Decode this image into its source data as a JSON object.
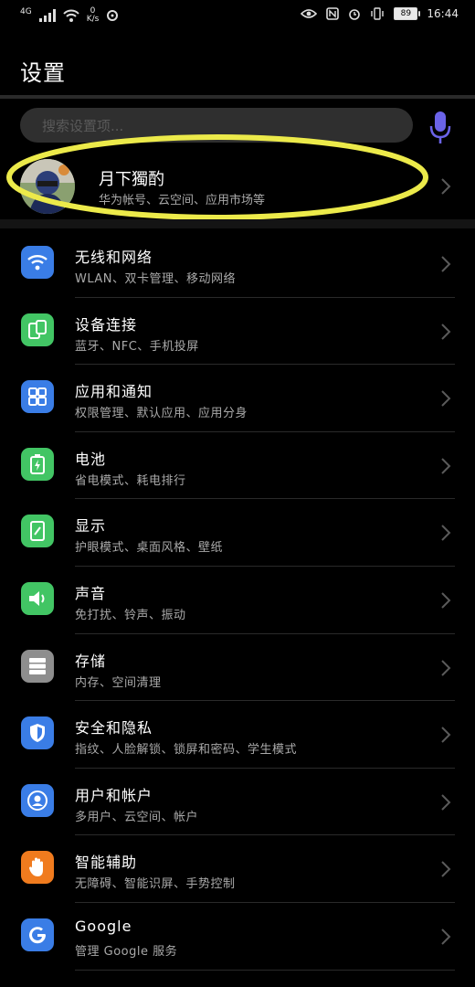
{
  "status_bar": {
    "network": "4G",
    "speed_value": "0",
    "speed_unit": "K/s",
    "battery": "89",
    "time": "16:44"
  },
  "header": {
    "title": "设置"
  },
  "search": {
    "placeholder": "搜索设置项..."
  },
  "account": {
    "name": "月下獨酌",
    "subtitle": "华为帐号、云空间、应用市场等"
  },
  "colors": {
    "background": "#000000",
    "highlight_ellipse": "#ecea4a",
    "mic": "#6b63e8"
  },
  "settings": {
    "items": [
      {
        "title": "无线和网络",
        "subtitle": "WLAN、双卡管理、移动网络",
        "icon": "wifi-icon",
        "color": "#3a7de6"
      },
      {
        "title": "设备连接",
        "subtitle": "蓝牙、NFC、手机投屏",
        "icon": "device-connect-icon",
        "color": "#42c564"
      },
      {
        "title": "应用和通知",
        "subtitle": "权限管理、默认应用、应用分身",
        "icon": "apps-icon",
        "color": "#3a7de6"
      },
      {
        "title": "电池",
        "subtitle": "省电模式、耗电排行",
        "icon": "battery-icon",
        "color": "#42c564"
      },
      {
        "title": "显示",
        "subtitle": "护眼模式、桌面风格、壁纸",
        "icon": "display-icon",
        "color": "#42c564"
      },
      {
        "title": "声音",
        "subtitle": "免打扰、铃声、振动",
        "icon": "sound-icon",
        "color": "#42c564"
      },
      {
        "title": "存储",
        "subtitle": "内存、空间清理",
        "icon": "storage-icon",
        "color": "#8e8e8e"
      },
      {
        "title": "安全和隐私",
        "subtitle": "指纹、人脸解锁、锁屏和密码、学生模式",
        "icon": "shield-icon",
        "color": "#3a7de6"
      },
      {
        "title": "用户和帐户",
        "subtitle": "多用户、云空间、帐户",
        "icon": "user-icon",
        "color": "#3a7de6"
      },
      {
        "title": "智能辅助",
        "subtitle": "无障碍、智能识屏、手势控制",
        "icon": "hand-icon",
        "color": "#f07b1e"
      },
      {
        "title": "Google",
        "subtitle": "管理 Google 服务",
        "icon": "google-icon",
        "color": "#3a7de6"
      }
    ]
  }
}
